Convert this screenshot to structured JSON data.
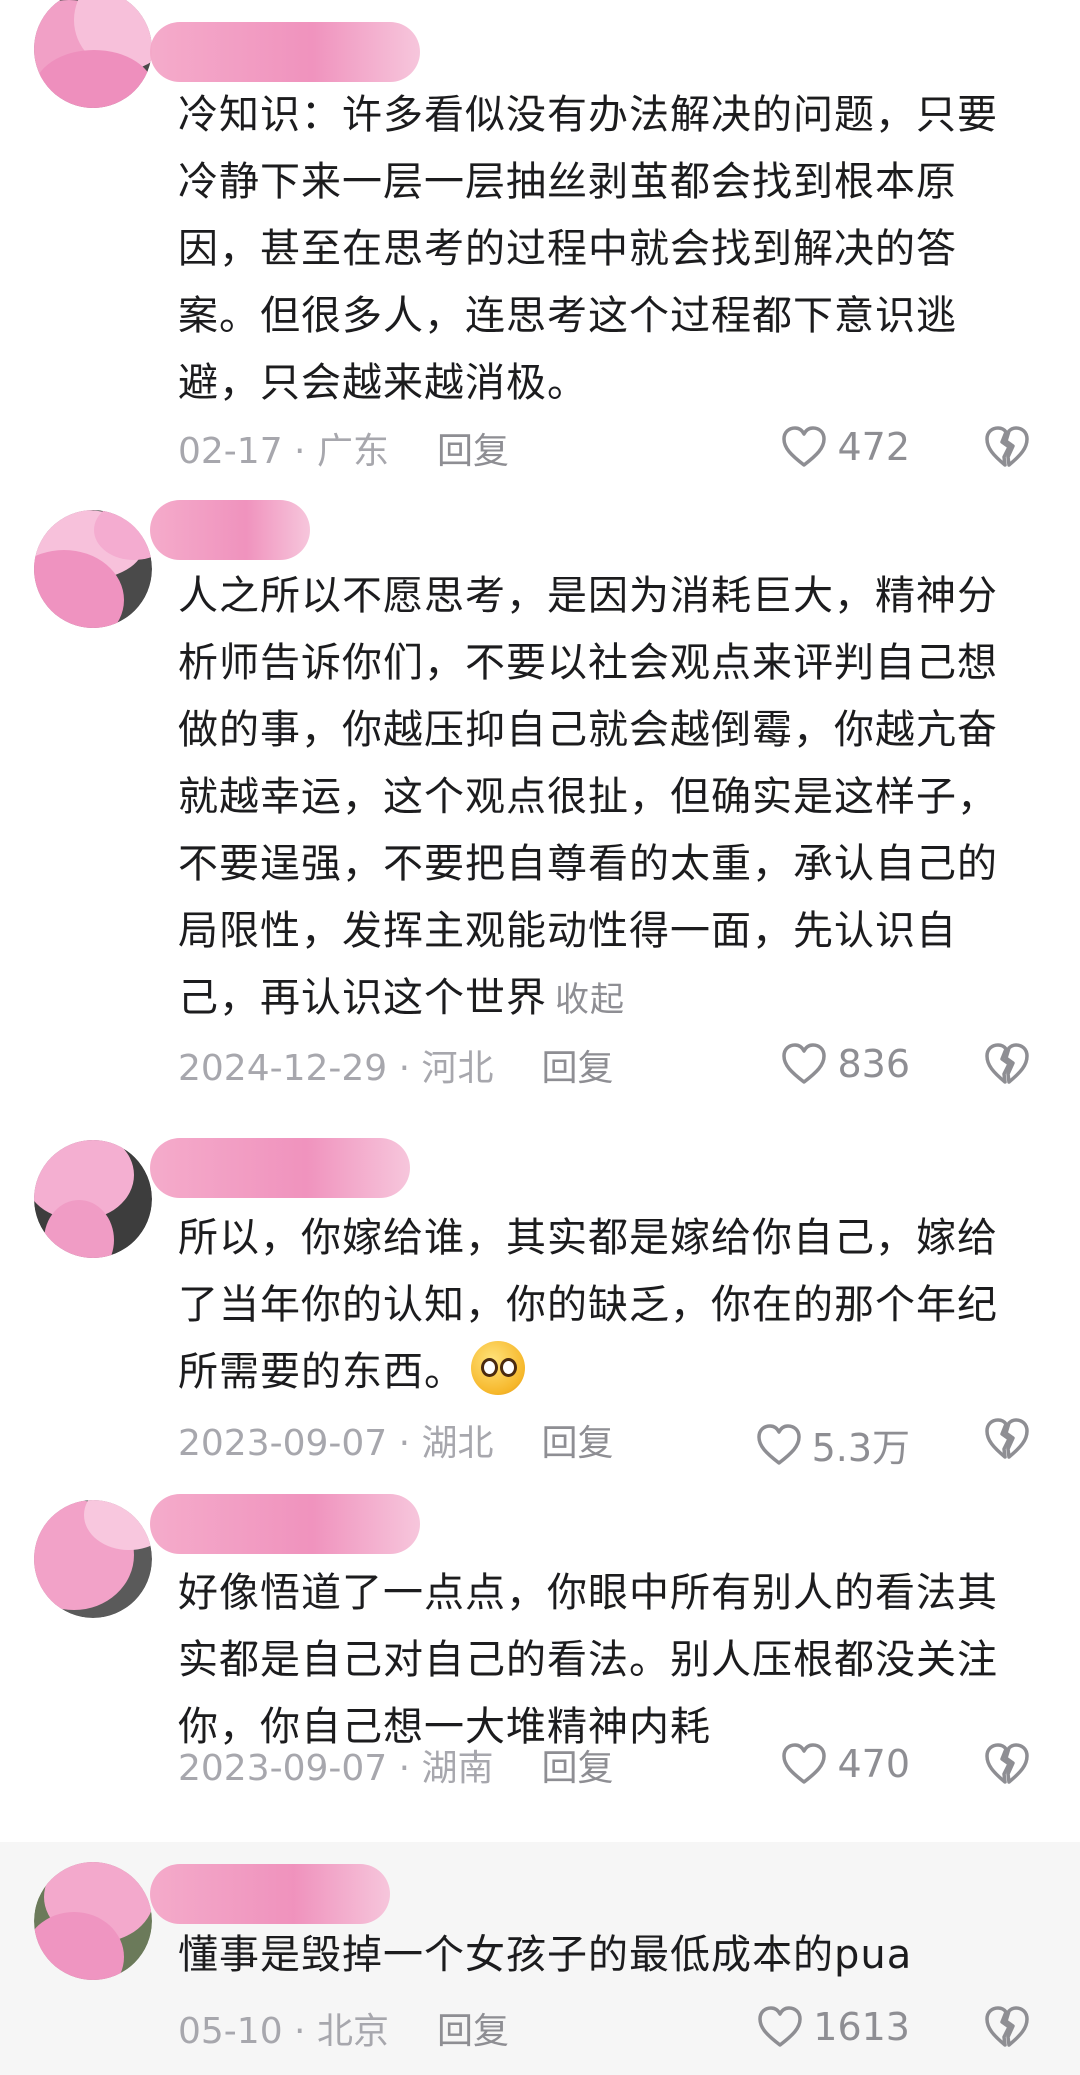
{
  "comments": [
    {
      "text": "冷知识：许多看似没有办法解决的问题，只要冷静下来一层一层抽丝剥茧都会找到根本原因，甚至在思考的过程中就会找到解决的答案。但很多人，连思考这个过程都下意识逃避，只会越来越消极。",
      "date_loc": "02-17 · 广东",
      "reply": "回复",
      "likes": "472"
    },
    {
      "text": "人之所以不愿思考，是因为消耗巨大，精神分析师告诉你们，不要以社会观点来评判自己想做的事，你越压抑自己就会越倒霉，你越亢奋就越幸运，这个观点很扯，但确实是这样子，不要逞强，不要把自尊看的太重，承认自己的局限性，发挥主观能动性得一面，先认识自己，再认识这个世界",
      "collapse": "收起",
      "date_loc": "2024-12-29 · 河北",
      "reply": "回复",
      "likes": "836"
    },
    {
      "text": "所以，你嫁给谁，其实都是嫁给你自己，嫁给了当年你的认知，你的缺乏，你在的那个年纪所需要的东西。",
      "date_loc": "2023-09-07 · 湖北",
      "reply": "回复",
      "likes": "5.3万"
    },
    {
      "text": "好像悟道了一点点，你眼中所有别人的看法其实都是自己对自己的看法。别人压根都没关注你，你自己想一大堆精神内耗",
      "date_loc": "2023-09-07 · 湖南",
      "reply": "回复",
      "likes": "470"
    },
    {
      "text": "懂事是毁掉一个女孩子的最低成本的pua",
      "date_loc": "05-10 · 北京",
      "reply": "回复",
      "likes": "1613"
    }
  ],
  "icons": {
    "like": "heart-outline-icon",
    "dislike": "broken-heart-outline-icon",
    "emoji": "smiling-face-icon"
  },
  "colors": {
    "censor_pink": "#f19bc4",
    "meta_gray": "#a7a7ad",
    "text": "#1c1c1e"
  }
}
